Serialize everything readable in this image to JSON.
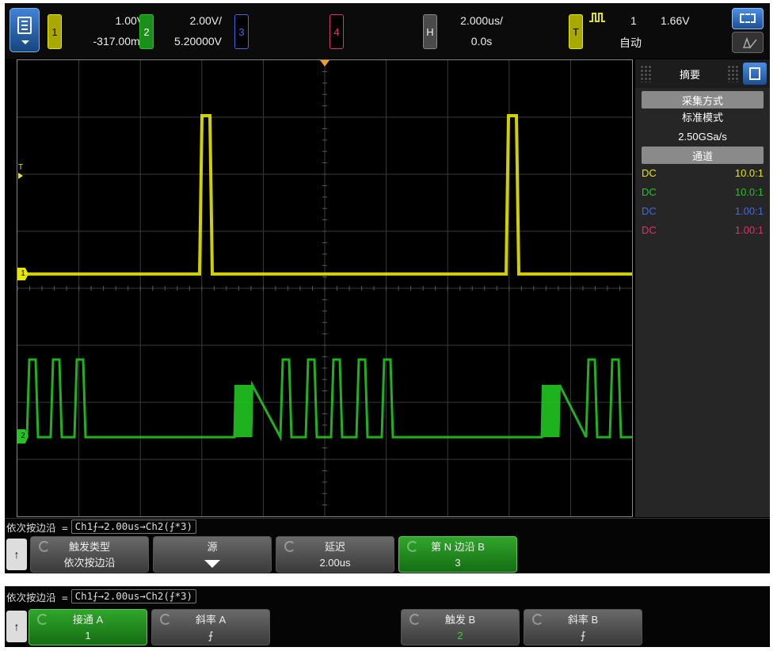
{
  "top_bar": {
    "ch1": {
      "label": "1",
      "scale": "1.00V/",
      "offset": "-317.00mV",
      "color": "#e6e600"
    },
    "ch2": {
      "label": "2",
      "scale": "2.00V/",
      "offset": "5.20000V",
      "color": "#22c522"
    },
    "ch3": {
      "label": "3",
      "color": "#4169e1"
    },
    "ch4": {
      "label": "4",
      "color": "#e0306a"
    },
    "horizontal": {
      "label": "H",
      "timebase": "2.000us/",
      "delay": "0.0s"
    },
    "trigger": {
      "label": "T",
      "source": "1",
      "level": "1.66V",
      "mode": "自动",
      "color": "#e6e600"
    }
  },
  "side_panel": {
    "tab_label": "摘要",
    "acquisition": {
      "header": "采集方式",
      "mode": "标准模式",
      "rate": "2.50GSa/s"
    },
    "channels": {
      "header": "通道",
      "rows": [
        {
          "coupling": "DC",
          "probe": "10.0:1",
          "color": "#e6e600"
        },
        {
          "coupling": "DC",
          "probe": "10.0:1",
          "color": "#22c522"
        },
        {
          "coupling": "DC",
          "probe": "1.00:1",
          "color": "#4169e1"
        },
        {
          "coupling": "DC",
          "probe": "1.00:1",
          "color": "#e0306a"
        }
      ]
    }
  },
  "markers": {
    "trigger_level": "T",
    "ch1_ground": "1",
    "ch2_ground": "2"
  },
  "softkeys_1": {
    "trigger_line": {
      "prefix": "依次按边沿 =",
      "sequence": "Ch1⨍→2.00us→Ch2(⨍*3)"
    },
    "keys": [
      {
        "title": "触发类型",
        "value": "依次按边沿"
      },
      {
        "title": "源",
        "value": ""
      },
      {
        "title": "延迟",
        "value": "2.00us"
      },
      {
        "title": "第 N 边沿 B",
        "value": "3"
      }
    ]
  },
  "softkeys_2": {
    "trigger_line": {
      "prefix": "依次按边沿 =",
      "sequence": "Ch1⨍→2.00us→Ch2(⨍*3)"
    },
    "keys": [
      {
        "title": "接通 A",
        "value": "1"
      },
      {
        "title": "斜率 A",
        "value": "⨍"
      },
      {
        "title": "触发 B",
        "value": "2"
      },
      {
        "title": "斜率 B",
        "value": "⨍"
      }
    ]
  }
}
